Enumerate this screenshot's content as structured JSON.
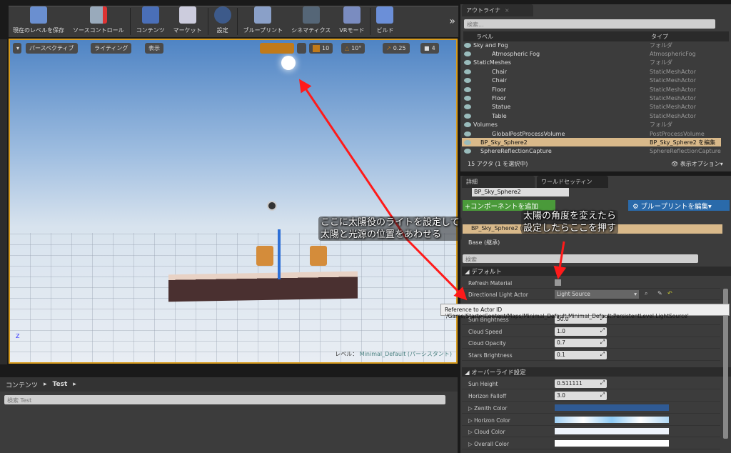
{
  "toolbar": {
    "items": [
      {
        "label": "現在のレベルを保存",
        "icon": "save-icon"
      },
      {
        "label": "ソースコントロール",
        "icon": "source-control-icon"
      },
      {
        "label": "コンテンツ",
        "icon": "content-icon"
      },
      {
        "label": "マーケット",
        "icon": "marketplace-icon"
      },
      {
        "label": "設定",
        "icon": "settings-icon"
      },
      {
        "label": "ブループリント",
        "icon": "blueprint-icon"
      },
      {
        "label": "シネマティクス",
        "icon": "cinematics-icon"
      },
      {
        "label": "VRモード",
        "icon": "vr-icon"
      },
      {
        "label": "ビルド",
        "icon": "build-icon"
      }
    ],
    "more": "»"
  },
  "viewport": {
    "perspective": "パースペクティブ",
    "lighting": "ライティング",
    "show": "表示",
    "grid_snap": "10",
    "rot_snap": "10°",
    "scale_snap": "0.25",
    "cam_speed": "4",
    "level_label": "レベル：",
    "level_name": "Minimal_Default (パーシスタント)",
    "axis_z": "Z"
  },
  "content_browser": {
    "root": "コンテンツ",
    "folder": "Test",
    "search_placeholder": "検索 Test"
  },
  "outliner": {
    "tab": "アウトライナ",
    "search_placeholder": "検索...",
    "col_label": "ラベル",
    "col_type": "タイプ",
    "rows": [
      {
        "label": "Sky and Fog",
        "type": "フォルダ",
        "indent": 1,
        "folder": true
      },
      {
        "label": "Atmospheric Fog",
        "type": "AtmosphericFog",
        "indent": 2
      },
      {
        "label": "StaticMeshes",
        "type": "フォルダ",
        "indent": 1,
        "folder": true
      },
      {
        "label": "Chair",
        "type": "StaticMeshActor",
        "indent": 2
      },
      {
        "label": "Chair",
        "type": "StaticMeshActor",
        "indent": 2
      },
      {
        "label": "Floor",
        "type": "StaticMeshActor",
        "indent": 2
      },
      {
        "label": "Floor",
        "type": "StaticMeshActor",
        "indent": 2
      },
      {
        "label": "Statue",
        "type": "StaticMeshActor",
        "indent": 2
      },
      {
        "label": "Table",
        "type": "StaticMeshActor",
        "indent": 2
      },
      {
        "label": "Volumes",
        "type": "フォルダ",
        "indent": 1,
        "folder": true
      },
      {
        "label": "GlobalPostProcessVolume",
        "type": "PostProcessVolume",
        "indent": 2
      },
      {
        "label": "BP_Sky_Sphere2",
        "type": "BP_Sky_Sphere2 を編集",
        "indent": 1,
        "selected": true
      },
      {
        "label": "SphereReflectionCapture",
        "type": "SphereReflectionCapture",
        "indent": 1
      }
    ],
    "status": "15 アクタ (1 を選択中)",
    "view_options": "表示オプション"
  },
  "details": {
    "tab": "詳細",
    "tab2": "ワールドセッティン",
    "name": "BP_Sky_Sphere2",
    "add_component": "+コンポーネントを追加",
    "edit_blueprint": "ブループリントを編集",
    "component_row": "BP_Sky_Sphere2 (s",
    "base": "Base (継承)",
    "search_placeholder": "検索",
    "section_default": "デフォルト",
    "refresh_material": "Refresh Material",
    "directional_light_actor": "Directional Light Actor",
    "light_value": "Light Source",
    "tooltip": "Reference to Actor ID '/Game/StarterContent/Maps/Minimal_Default.Minimal_Default:PersistentLevel.LightSource'",
    "props": [
      {
        "label": "Sun Brightness",
        "value": "50.0"
      },
      {
        "label": "Cloud Speed",
        "value": "1.0"
      },
      {
        "label": "Cloud Opacity",
        "value": "0.7"
      },
      {
        "label": "Stars Brightness",
        "value": "0.1"
      }
    ],
    "section_override": "オーバーライド設定",
    "override_props": [
      {
        "label": "Sun Height",
        "value": "0.511111"
      },
      {
        "label": "Horizon Falloff",
        "value": "3.0"
      }
    ],
    "colors": [
      {
        "label": "Zenith Color",
        "color": "#2f5a94"
      },
      {
        "label": "Horizon Color",
        "color": "#b0d8f5"
      },
      {
        "label": "Cloud Color",
        "color": "#eef4fc"
      },
      {
        "label": "Overall Color",
        "color": "#ffffff"
      }
    ]
  },
  "annotations": {
    "note1_line1": "ここに太陽役のライトを設定して",
    "note1_line2": "太陽と光源の位置をあわせる",
    "note2_line1": "太陽の角度を変えたら",
    "note2_line2": "設定したらここを押す",
    "arrow_color": "#ff1a1a"
  }
}
